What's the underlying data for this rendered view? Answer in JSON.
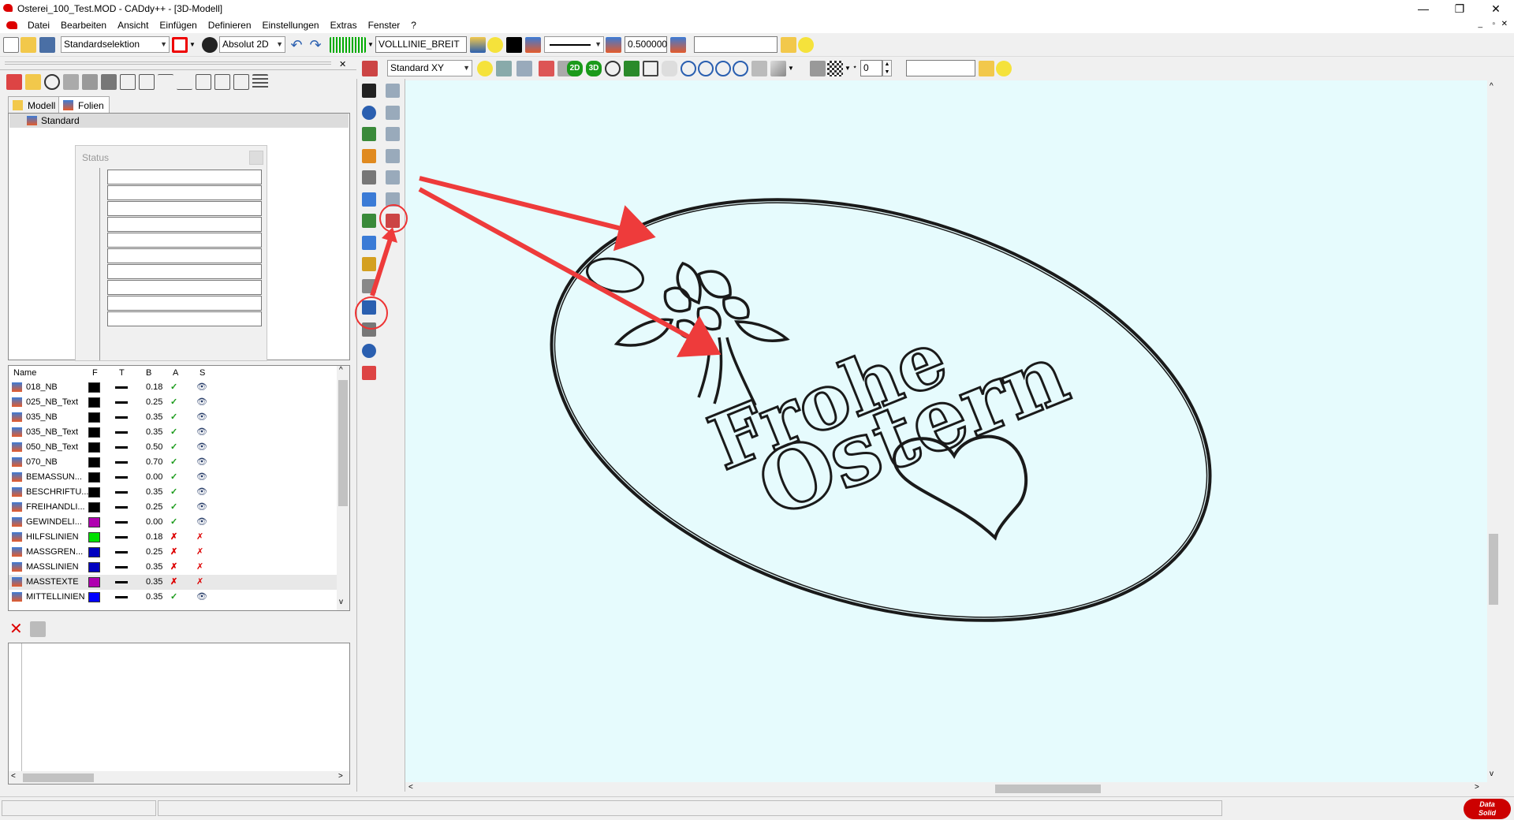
{
  "window": {
    "title": "Osterei_100_Test.MOD - CADdy++ - [3D-Modell]",
    "minimize": "—",
    "restore": "❐",
    "close": "✕"
  },
  "menu": [
    "Datei",
    "Bearbeiten",
    "Ansicht",
    "Einfügen",
    "Definieren",
    "Einstellungen",
    "Extras",
    "Fenster",
    "?"
  ],
  "toolbar1": {
    "selection": "Standardselektion",
    "coord_mode": "Absolut 2D",
    "line_type": "VOLLLINIE_BREIT",
    "line_width": "0.500000",
    "search": ""
  },
  "toolbar2": {
    "view": "Standard XY",
    "btn_2d": "2D",
    "btn_3d": "3D",
    "level": "0",
    "search": ""
  },
  "panel_tabs": [
    "Modell",
    "Folien"
  ],
  "tree": {
    "root": "Standard"
  },
  "status_window": {
    "title": "Status"
  },
  "layers": {
    "headers": [
      "Name",
      "F",
      "T",
      "B",
      "A",
      "S"
    ],
    "rows": [
      {
        "name": "018_NB",
        "color": "#000000",
        "width": "0.18",
        "active": "✓",
        "visible": "👁"
      },
      {
        "name": "025_NB_Text",
        "color": "#000000",
        "width": "0.25",
        "active": "✓",
        "visible": "👁"
      },
      {
        "name": "035_NB",
        "color": "#000000",
        "width": "0.35",
        "active": "✓",
        "visible": "👁"
      },
      {
        "name": "035_NB_Text",
        "color": "#000000",
        "width": "0.35",
        "active": "✓",
        "visible": "👁"
      },
      {
        "name": "050_NB_Text",
        "color": "#000000",
        "width": "0.50",
        "active": "✓",
        "visible": "👁"
      },
      {
        "name": "070_NB",
        "color": "#000000",
        "width": "0.70",
        "active": "✓",
        "visible": "👁"
      },
      {
        "name": "BEMASSUN...",
        "color": "#000000",
        "width": "0.00",
        "active": "✓",
        "visible": "👁"
      },
      {
        "name": "BESCHRIFTU...",
        "color": "#000000",
        "width": "0.35",
        "active": "✓",
        "visible": "👁"
      },
      {
        "name": "FREIHANDLI...",
        "color": "#000000",
        "width": "0.25",
        "active": "✓",
        "visible": "👁"
      },
      {
        "name": "GEWINDELI...",
        "color": "#b000b0",
        "width": "0.00",
        "active": "✓",
        "visible": "👁"
      },
      {
        "name": "HILFSLINIEN",
        "color": "#00e000",
        "width": "0.18",
        "active": "✗",
        "visible": "✗"
      },
      {
        "name": "MASSGREN...",
        "color": "#0000c0",
        "width": "0.25",
        "active": "✗",
        "visible": "✗"
      },
      {
        "name": "MASSLINIEN",
        "color": "#0000c0",
        "width": "0.35",
        "active": "✗",
        "visible": "✗"
      },
      {
        "name": "MASSTEXTE",
        "color": "#b000b0",
        "width": "0.35",
        "active": "✗",
        "visible": "✗"
      },
      {
        "name": "MITTELLINIEN",
        "color": "#0000ff",
        "width": "0.35",
        "active": "✓",
        "visible": "👁"
      }
    ]
  },
  "drawing": {
    "text_line1": "Frohe",
    "text_line2": "Ostern"
  },
  "brand": {
    "logo_line1": "Data",
    "logo_line2": "Solid"
  },
  "colors": {
    "canvas": "#e6fbfd",
    "arrow": "#ee3b3b",
    "highlight": "#e33"
  }
}
